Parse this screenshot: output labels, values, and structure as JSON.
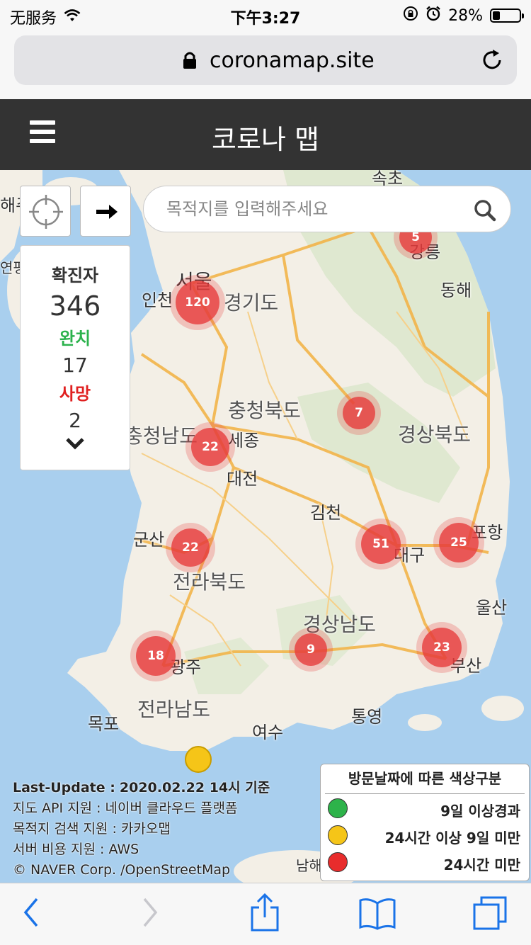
{
  "status_bar": {
    "carrier": "无服务",
    "time": "下午3:27",
    "battery_pct": "28%",
    "battery_level": 0.28
  },
  "browser": {
    "url": "coronamap.site"
  },
  "header": {
    "title": "코로나 맵"
  },
  "search": {
    "placeholder": "목적지를 입력해주세요"
  },
  "stats": {
    "confirmed_label": "확진자",
    "confirmed": "346",
    "recovered_label": "완치",
    "recovered": "17",
    "deaths_label": "사망",
    "deaths": "2"
  },
  "map": {
    "places": [
      "속초",
      "해주",
      "연평",
      "강릉",
      "동해",
      "서울",
      "인천",
      "경기도",
      "충청북도",
      "경상북도",
      "충청남도",
      "세종",
      "대전",
      "김천",
      "군산",
      "대구",
      "포항",
      "전라북도",
      "울산",
      "경상남도",
      "광주",
      "부산",
      "전라남도",
      "목포",
      "통영",
      "여수",
      "남해"
    ],
    "clusters": [
      "120",
      "5",
      "7",
      "22",
      "22",
      "51",
      "25",
      "18",
      "9",
      "23"
    ]
  },
  "info": {
    "last_update_label": "Last-Update :",
    "last_update_value": "2020.02.22 14시 기준",
    "map_api": "지도 API 지원 : 네이버 클라우드 플랫폼",
    "search_support": "목적지 검색 지원 : 카카오맵",
    "server_support": "서버 비용 지원 : AWS",
    "copyright": "© NAVER Corp. /OpenStreetMap"
  },
  "legend": {
    "title": "방문날짜에 따른 색상구분",
    "items": [
      {
        "label": "9일 이상경과",
        "color": "#2db34a"
      },
      {
        "label": "24시간 이상 9일 미만",
        "color": "#f5c518"
      },
      {
        "label": "24시간 미만",
        "color": "#e82c2c"
      }
    ]
  }
}
